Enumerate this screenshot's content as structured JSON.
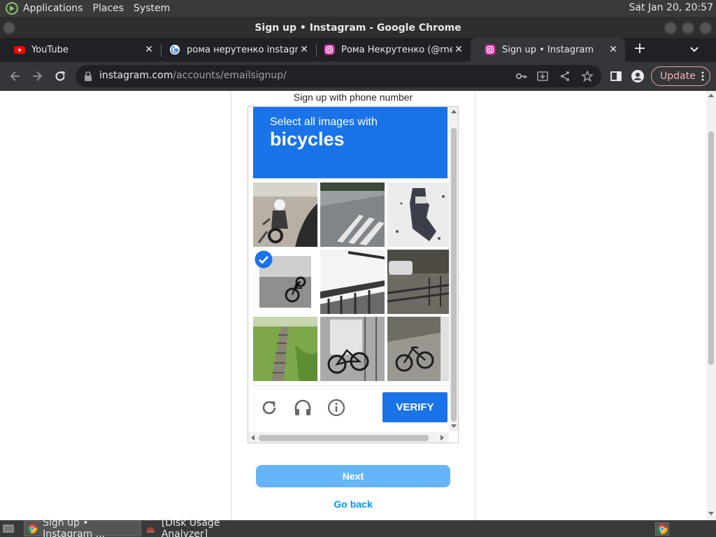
{
  "top_panel": {
    "menus": [
      "Applications",
      "Places",
      "System"
    ],
    "clock": "Sat Jan 20, 20:57"
  },
  "window": {
    "title": "Sign up • Instagram - Google Chrome"
  },
  "tabs": [
    {
      "title": "YouTube",
      "favicon": "youtube-icon"
    },
    {
      "title": "рома нерутенко instagram",
      "favicon": "google-icon"
    },
    {
      "title": "Рома Некрутенко (@rnekr",
      "favicon": "instagram-icon"
    },
    {
      "title": "Sign up • Instagram",
      "favicon": "instagram-icon",
      "active": true
    }
  ],
  "toolbar": {
    "url_host": "instagram.com",
    "url_path": "/accounts/emailsignup/",
    "update_label": "Update"
  },
  "page": {
    "phone_link": "Sign up with phone number",
    "captcha": {
      "prompt_line1": "Select all images with",
      "prompt_target": "bicycles",
      "selected_tiles": [
        3
      ],
      "verify_label": "VERIFY"
    },
    "next_label": "Next",
    "go_back_label": "Go back"
  },
  "taskbar": {
    "items": [
      {
        "label": "Sign up • Instagram ...",
        "icon": "chrome-icon",
        "active": true
      },
      {
        "label": "[Disk Usage Analyzer]",
        "icon": "disk-usage-icon",
        "active": false
      }
    ]
  },
  "colors": {
    "captcha_blue": "#1a73e8",
    "next_button": "#67b5f9",
    "link_blue": "#0095f6"
  }
}
